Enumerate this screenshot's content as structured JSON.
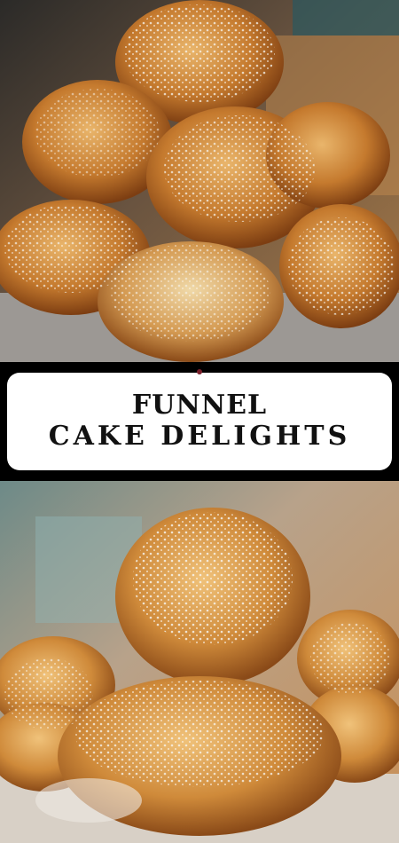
{
  "title": {
    "line1": "FUNNEL",
    "line2": "CAKE DELIGHTS"
  },
  "images": {
    "top": "funnel-cakes-powdered-sugar-stack-top-photo",
    "bottom": "funnel-cakes-powdered-sugar-stack-bottom-photo"
  },
  "colors": {
    "card_bg": "#ffffff",
    "band_bg": "#000000",
    "text": "#111111",
    "accent": "#7a1f2b"
  }
}
